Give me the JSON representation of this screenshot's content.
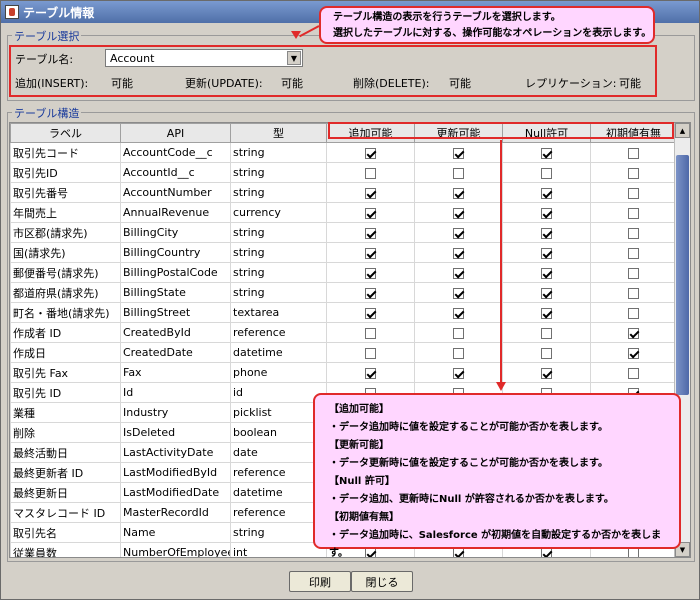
{
  "window": {
    "title": "テーブル情報"
  },
  "callout_top": {
    "lines": [
      "テーブル構造の表示を行うテーブルを選択します。",
      "選択したテーブルに対する、操作可能なオペレーションを表示します。"
    ]
  },
  "selection": {
    "group_label": "テーブル選択",
    "table_name_label": "テーブル名:",
    "table_name_value": "Account",
    "ops": [
      {
        "label": "追加(INSERT):",
        "value": "可能"
      },
      {
        "label": "更新(UPDATE):",
        "value": "可能"
      },
      {
        "label": "削除(DELETE):",
        "value": "可能"
      },
      {
        "label": "レプリケーション:",
        "value": "可能"
      }
    ]
  },
  "structure": {
    "group_label": "テーブル構造",
    "columns": [
      "ラベル",
      "API",
      "型",
      "追加可能",
      "更新可能",
      "Null許可",
      "初期値有無"
    ],
    "rows": [
      {
        "label": "取引先コード",
        "api": "AccountCode__c",
        "type": "string",
        "flags": [
          true,
          true,
          true,
          false
        ]
      },
      {
        "label": "取引先ID",
        "api": "AccountId__c",
        "type": "string",
        "flags": [
          false,
          false,
          false,
          false
        ]
      },
      {
        "label": "取引先番号",
        "api": "AccountNumber",
        "type": "string",
        "flags": [
          true,
          true,
          true,
          false
        ]
      },
      {
        "label": "年間売上",
        "api": "AnnualRevenue",
        "type": "currency",
        "flags": [
          true,
          true,
          true,
          false
        ]
      },
      {
        "label": "市区郡(請求先)",
        "api": "BillingCity",
        "type": "string",
        "flags": [
          true,
          true,
          true,
          false
        ]
      },
      {
        "label": "国(請求先)",
        "api": "BillingCountry",
        "type": "string",
        "flags": [
          true,
          true,
          true,
          false
        ]
      },
      {
        "label": "郵便番号(請求先)",
        "api": "BillingPostalCode",
        "type": "string",
        "flags": [
          true,
          true,
          true,
          false
        ]
      },
      {
        "label": "都道府県(請求先)",
        "api": "BillingState",
        "type": "string",
        "flags": [
          true,
          true,
          true,
          false
        ]
      },
      {
        "label": "町名・番地(請求先)",
        "api": "BillingStreet",
        "type": "textarea",
        "flags": [
          true,
          true,
          true,
          false
        ]
      },
      {
        "label": "作成者 ID",
        "api": "CreatedById",
        "type": "reference",
        "flags": [
          false,
          false,
          false,
          true
        ]
      },
      {
        "label": "作成日",
        "api": "CreatedDate",
        "type": "datetime",
        "flags": [
          false,
          false,
          false,
          true
        ]
      },
      {
        "label": "取引先 Fax",
        "api": "Fax",
        "type": "phone",
        "flags": [
          true,
          true,
          true,
          false
        ]
      },
      {
        "label": "取引先 ID",
        "api": "Id",
        "type": "id",
        "flags": [
          false,
          false,
          false,
          true
        ]
      },
      {
        "label": "業種",
        "api": "Industry",
        "type": "picklist",
        "flags": [
          true,
          true,
          true,
          false
        ]
      },
      {
        "label": "削除",
        "api": "IsDeleted",
        "type": "boolean",
        "flags": [
          false,
          false,
          false,
          false
        ]
      },
      {
        "label": "最終活動日",
        "api": "LastActivityDate",
        "type": "date",
        "flags": [
          false,
          false,
          false,
          false
        ]
      },
      {
        "label": "最終更新者 ID",
        "api": "LastModifiedById",
        "type": "reference",
        "flags": [
          false,
          false,
          false,
          false
        ]
      },
      {
        "label": "最終更新日",
        "api": "LastModifiedDate",
        "type": "datetime",
        "flags": [
          false,
          false,
          false,
          false
        ]
      },
      {
        "label": "マスタレコード ID",
        "api": "MasterRecordId",
        "type": "reference",
        "flags": [
          false,
          false,
          false,
          false
        ]
      },
      {
        "label": "取引先名",
        "api": "Name",
        "type": "string",
        "flags": [
          false,
          false,
          false,
          false
        ]
      },
      {
        "label": "従業員数",
        "api": "NumberOfEmployees",
        "type": "int",
        "flags": [
          true,
          true,
          true,
          false
        ]
      }
    ]
  },
  "callout_bottom": {
    "lines": [
      "【追加可能】",
      "・データ追加時に値を設定することが可能か否かを表します。",
      "【更新可能】",
      "・データ更新時に値を設定することが可能か否かを表します。",
      "【Null 許可】",
      "・データ追加、更新時にNull が許容されるか否かを表します。",
      "【初期値有無】",
      "・データ追加時に、Salesforce が初期値を自動設定するか否かを表します。"
    ]
  },
  "buttons": {
    "print": "印刷",
    "close": "閉じる"
  },
  "icons": {
    "app": "java-cup-icon",
    "dropdown": "chevron-down-icon",
    "scroll_up": "scroll-up-icon",
    "scroll_down": "scroll-down-icon"
  },
  "colors": {
    "highlight": "#e02a2a",
    "callout_fill": "#ffd6ff",
    "titlebar": "#5b7bb8"
  }
}
